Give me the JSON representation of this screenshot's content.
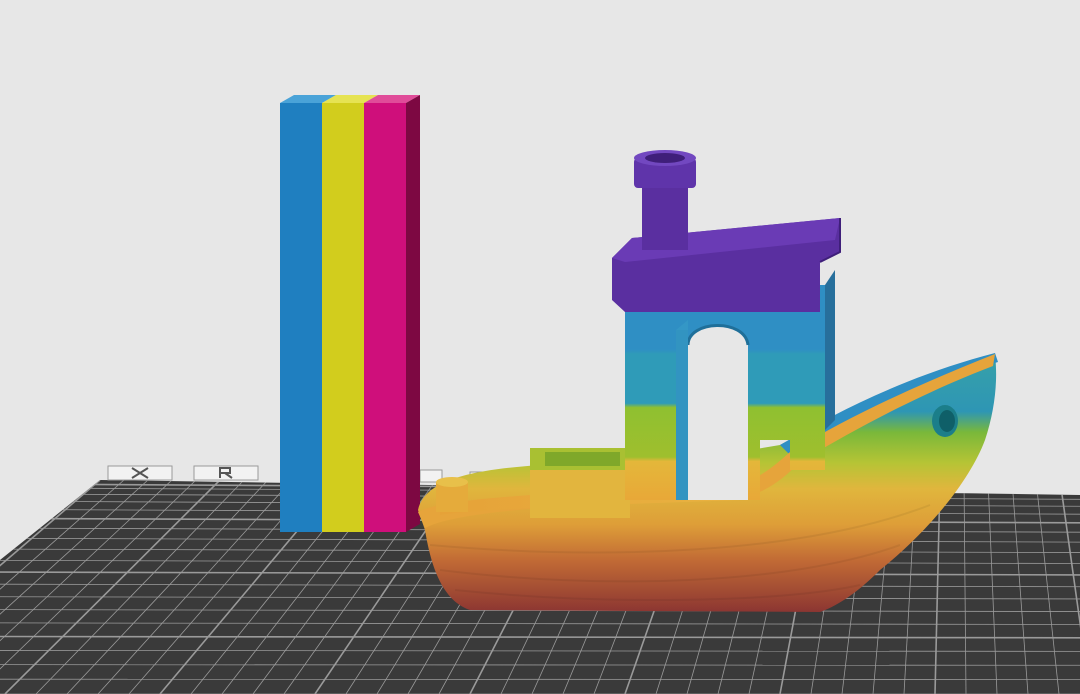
{
  "viewport": {
    "background": "#e7e7e7",
    "bed_color": "#3a3a3a",
    "grid_color": "#9a9a9a"
  },
  "purge_tower": {
    "stripe_colors": [
      "#1f7fc0",
      "#d2cd1d",
      "#cf0f7b"
    ],
    "side_color": "#7d0842",
    "top_colors": [
      "#4aa3d8",
      "#e6e352",
      "#e04c99"
    ]
  },
  "benchy": {
    "layer_colors": [
      "#8e3a34",
      "#c46a34",
      "#e4a536",
      "#e2c33e",
      "#9fbf2e",
      "#3aa7a3",
      "#2f8fc4",
      "#5a2fa0"
    ]
  },
  "bed_icons": [
    "x-icon",
    "r-icon",
    "square-icon",
    "target-icon"
  ]
}
